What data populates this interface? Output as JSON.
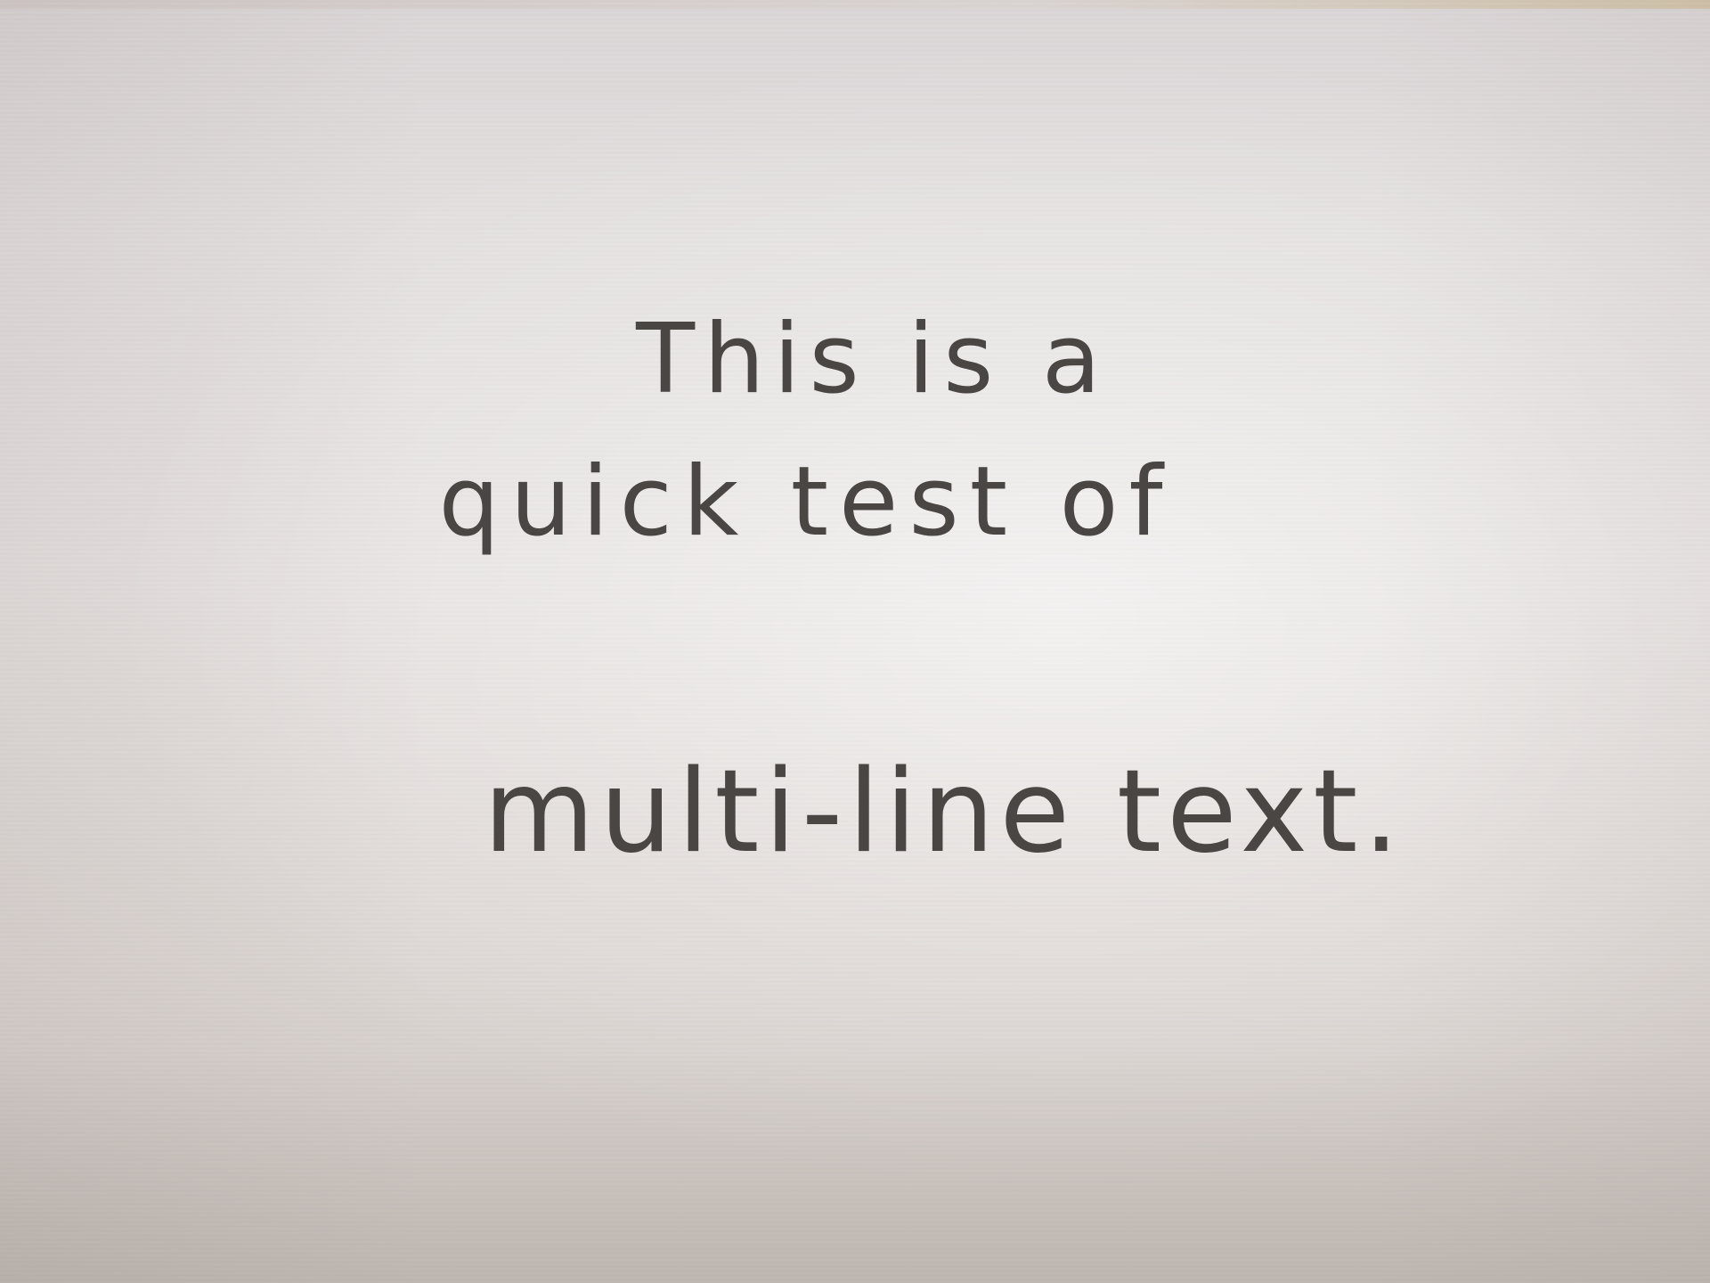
{
  "note": {
    "lines": [
      "This is a",
      "quick test of",
      "multi-line text."
    ]
  },
  "colors": {
    "paper": "#e4e0df",
    "ink": "#4a4644"
  }
}
